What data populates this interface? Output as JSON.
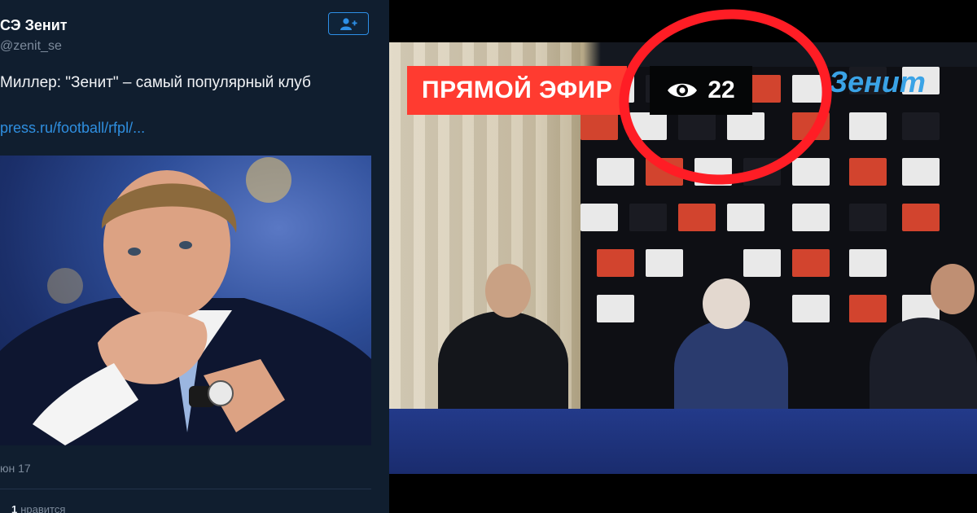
{
  "tweet": {
    "account_name": "СЭ Зенит",
    "account_handle": "@zenit_se",
    "follow_icon": "add-user-icon",
    "text": "Миллер: \"Зенит\" – самый популярный клуб",
    "link": "press.ru/football/rfpl/...",
    "date": "юн 17",
    "likes_count": "1",
    "likes_label": "нравится"
  },
  "live": {
    "badge_label": "ПРЯМОЙ ЭФИР",
    "views_icon": "eye-icon",
    "views_count": "22",
    "brand_text": "Зенит"
  },
  "colors": {
    "tweet_bg": "#101e2f",
    "link": "#2f8fe0",
    "live_badge": "#ff3b30",
    "highlight_ring": "#ff1d25"
  }
}
